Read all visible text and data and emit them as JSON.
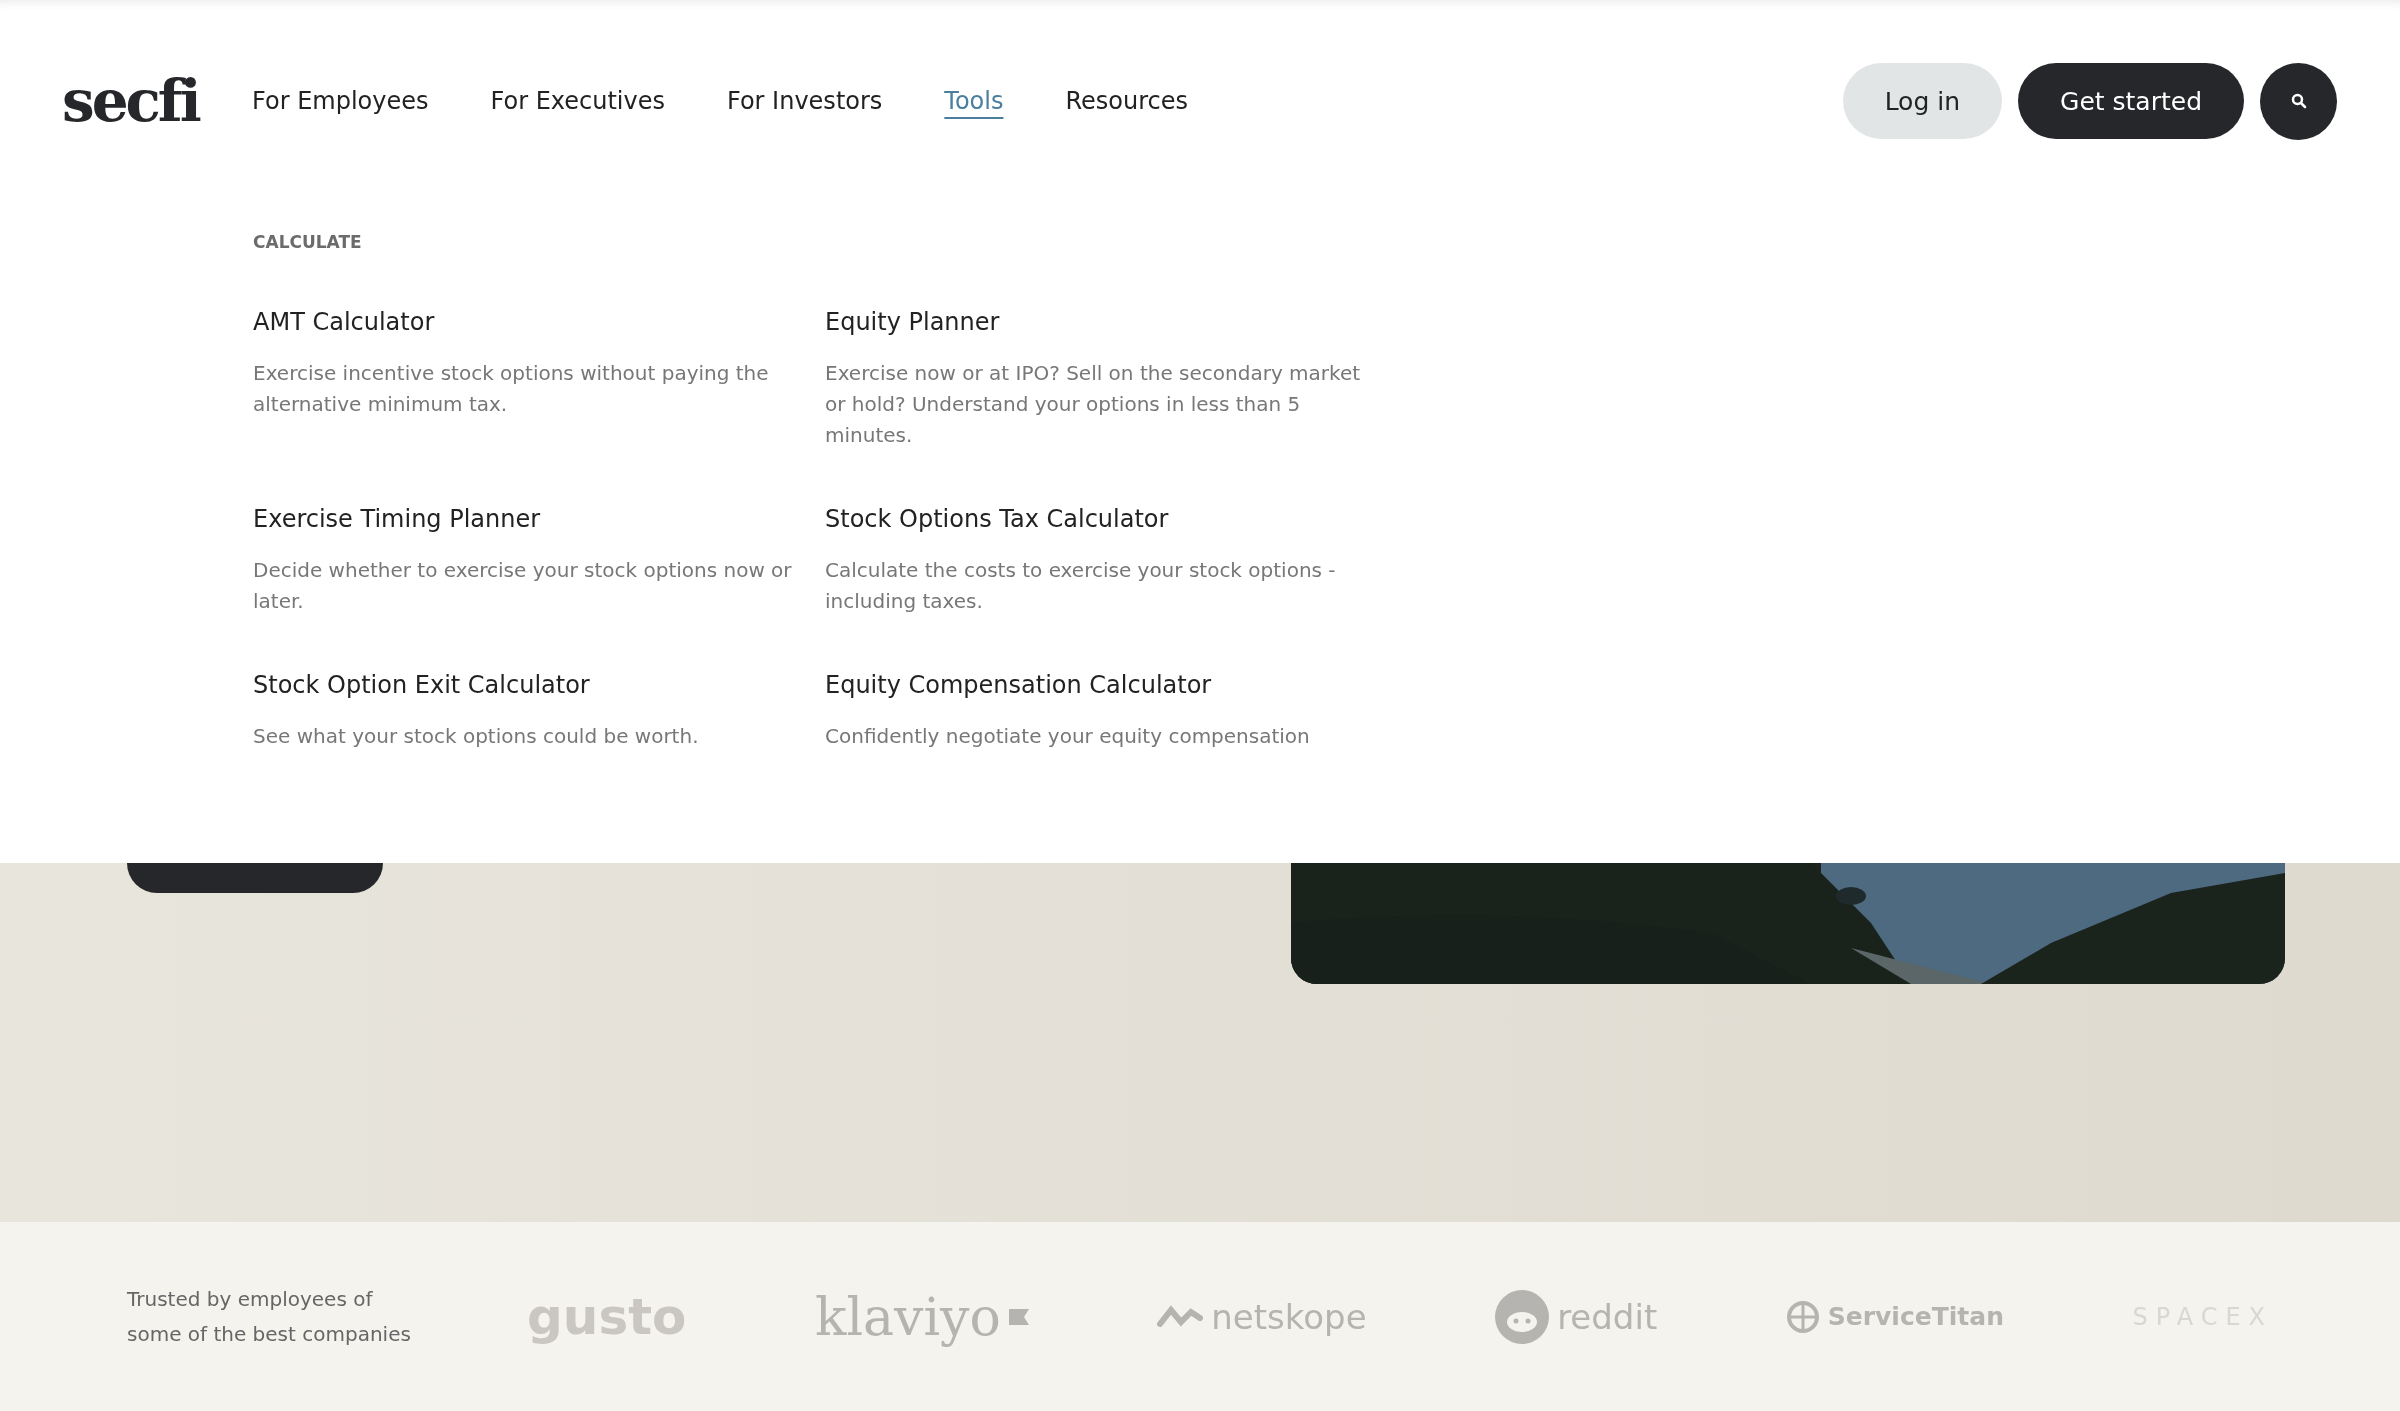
{
  "header": {
    "logo": "secfi",
    "nav": [
      {
        "label": "For Employees",
        "selected": false
      },
      {
        "label": "For Executives",
        "selected": false
      },
      {
        "label": "For Investors",
        "selected": false
      },
      {
        "label": "Tools",
        "selected": true
      },
      {
        "label": "Resources",
        "selected": false
      }
    ],
    "login": "Log in",
    "get_started": "Get started"
  },
  "menu": {
    "section": "CALCULATE",
    "items": [
      {
        "title": "AMT Calculator",
        "description": "Exercise incentive stock options without paying the alternative minimum tax."
      },
      {
        "title": "Equity Planner",
        "description": "Exercise now or at IPO? Sell on the secondary market or hold? Understand your options in less than 5 minutes."
      },
      {
        "title": "Exercise Timing Planner",
        "description": "Decide whether to exercise your stock options now or later."
      },
      {
        "title": "Stock Options Tax Calculator",
        "description": "Calculate the costs to exercise your stock options - including taxes."
      },
      {
        "title": "Stock Option Exit Calculator",
        "description": "See what your stock options could be worth."
      },
      {
        "title": "Equity Compensation Calculator",
        "description": "Confidently negotiate your equity compensation"
      }
    ]
  },
  "trusted": {
    "text": "Trusted by employees of some of the best companies",
    "logos": [
      {
        "kind": "gusto",
        "name": "gusto"
      },
      {
        "kind": "klaviyo",
        "name": "klaviyo"
      },
      {
        "kind": "netskope",
        "name": "netskope"
      },
      {
        "kind": "reddit",
        "name": "reddit"
      },
      {
        "kind": "servicetitan",
        "name": "ServiceTitan"
      },
      {
        "kind": "spacex",
        "name": "SPACEX"
      }
    ]
  }
}
